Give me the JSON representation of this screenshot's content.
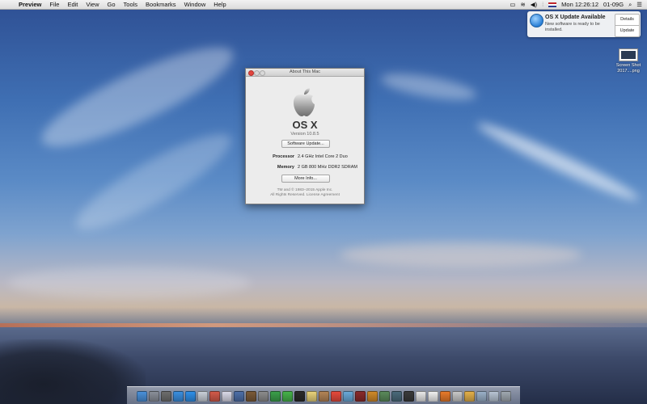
{
  "menubar": {
    "app_name": "Preview",
    "menus": [
      "File",
      "Edit",
      "View",
      "Go",
      "Tools",
      "Bookmarks",
      "Window",
      "Help"
    ],
    "clock": "Mon 12:26:12",
    "date": "01-09G"
  },
  "notification": {
    "title": "OS X Update Available",
    "body": "New software is ready to be installed.",
    "details_label": "Details",
    "update_label": "Update"
  },
  "desktop_file": {
    "name": "Screen Shot 2017....png"
  },
  "about_window": {
    "title": "About This Mac",
    "os_name": "OS X",
    "version": "Version 10.8.5",
    "software_update_label": "Software Update...",
    "processor_label": "Processor",
    "processor_value": "2.4 GHz Intel Core 2 Duo",
    "memory_label": "Memory",
    "memory_value": "2 GB 800 MHz DDR2 SDRAM",
    "more_info_label": "More Info...",
    "footer_line1": "TM and © 1983–2015 Apple Inc.",
    "footer_line2": "All Rights Reserved.   License Agreement"
  },
  "dock": {
    "icons": [
      {
        "name": "finder-icon",
        "color": "#4a90d9"
      },
      {
        "name": "launchpad-icon",
        "color": "#8a8f99"
      },
      {
        "name": "mission-control-icon",
        "color": "#6d6d6d"
      },
      {
        "name": "app-store-icon",
        "color": "#3b8fe0"
      },
      {
        "name": "safari-icon",
        "color": "#2f8fe8"
      },
      {
        "name": "mail-icon",
        "color": "#c9cfd8"
      },
      {
        "name": "photos-icon",
        "color": "#d35a4a"
      },
      {
        "name": "itunes-icon",
        "color": "#d9d9e8"
      },
      {
        "name": "preview-icon",
        "color": "#4d6fa8"
      },
      {
        "name": "chess-icon",
        "color": "#7a5a38"
      },
      {
        "name": "system-prefs-icon",
        "color": "#8c8c8c"
      },
      {
        "name": "chrome-icon",
        "color": "#3a9f4a"
      },
      {
        "name": "messages-icon",
        "color": "#46b34a"
      },
      {
        "name": "terminal-icon",
        "color": "#2a2a2a"
      },
      {
        "name": "notes-icon",
        "color": "#e8d27a"
      },
      {
        "name": "contacts-icon",
        "color": "#b38456"
      },
      {
        "name": "calendar-icon",
        "color": "#e64a3c"
      },
      {
        "name": "maps-icon",
        "color": "#6aa9d8"
      },
      {
        "name": "photo-booth-icon",
        "color": "#8a2a2a"
      },
      {
        "name": "books-icon",
        "color": "#d08a2a"
      },
      {
        "name": "facetime-icon",
        "color": "#5a8a5a"
      },
      {
        "name": "time-machine-icon",
        "color": "#4a6a7a"
      },
      {
        "name": "activity-monitor-icon",
        "color": "#3a3a3a"
      },
      {
        "name": "reminders-icon",
        "color": "#e8e8e8"
      },
      {
        "name": "textedit-icon",
        "color": "#f0f0f0"
      },
      {
        "name": "firefox-icon",
        "color": "#e87a2a"
      },
      {
        "name": "archive-icon",
        "color": "#c8c8c8"
      },
      {
        "name": "airdrop-icon",
        "color": "#e3b04a"
      },
      {
        "name": "downloads-icon",
        "color": "#9ab0c8"
      },
      {
        "name": "documents-icon",
        "color": "#b8c4d4"
      },
      {
        "name": "trash-icon",
        "color": "#a0a8b0"
      }
    ]
  },
  "colors": {
    "close": "#e2463f",
    "accent": "#2a7fd6"
  }
}
